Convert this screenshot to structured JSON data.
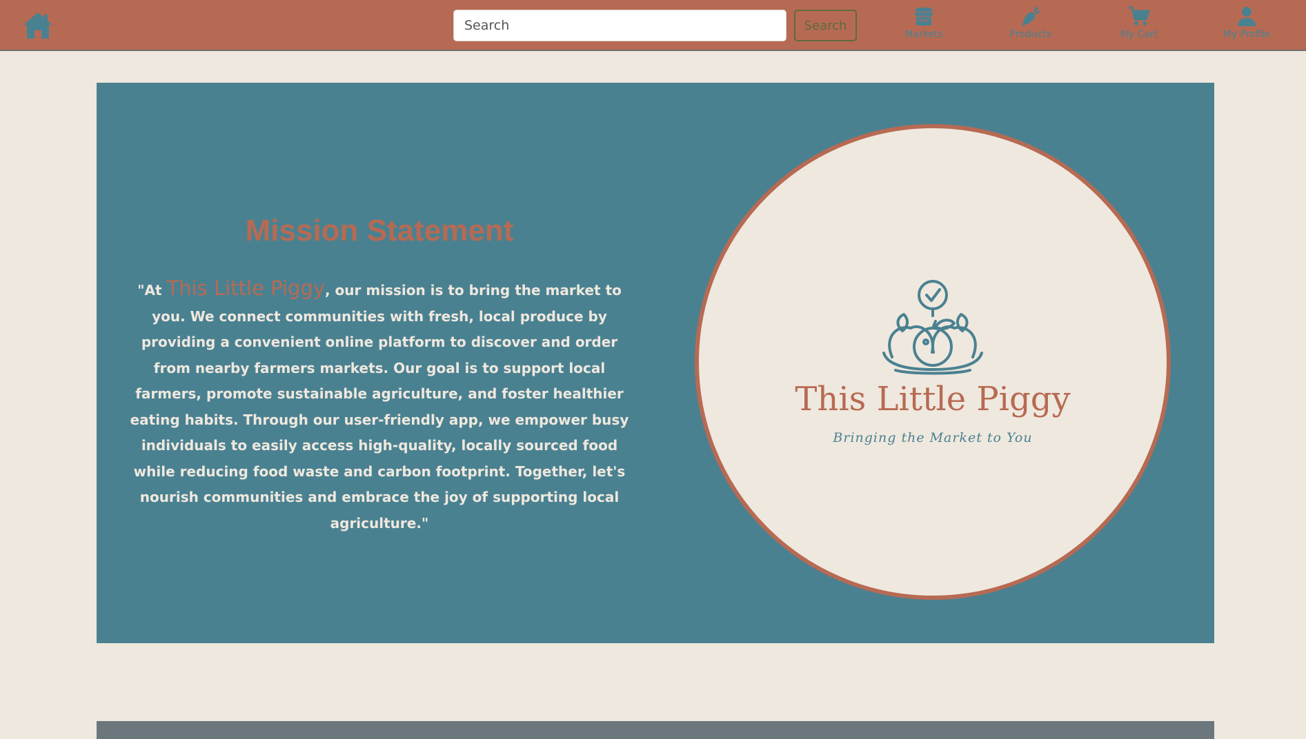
{
  "nav": {
    "search_placeholder": "Search",
    "search_button": "Search",
    "items": [
      {
        "label": "Markets",
        "icon": "store-icon"
      },
      {
        "label": "Products",
        "icon": "carrot-icon"
      },
      {
        "label": "My Cart",
        "icon": "cart-icon"
      },
      {
        "label": "My Profile",
        "icon": "user-icon"
      }
    ]
  },
  "mission": {
    "title": "Mission Statement",
    "quote_open": "\"At ",
    "brand": "This Little Piggy",
    "body": ", our mission is to bring the market to you. We connect communities with fresh, local produce by providing a convenient online platform to discover and order from nearby farmers markets. Our goal is to support local farmers, promote sustainable agriculture, and foster healthier eating habits. Through our user-friendly app, we empower busy individuals to easily access high-quality, locally sourced food while reducing food waste and carbon footprint. Together, let's nourish communities and embrace the joy of supporting local agriculture.\""
  },
  "logo": {
    "name": "This Little Piggy",
    "tagline": "Bringing the Market to You"
  },
  "colors": {
    "nav_bg": "#b76a53",
    "page_bg": "#efe8de",
    "panel_bg": "#4a8191",
    "accent": "#b76a53",
    "icon_teal": "#4a8191",
    "footer": "#6b777c"
  }
}
